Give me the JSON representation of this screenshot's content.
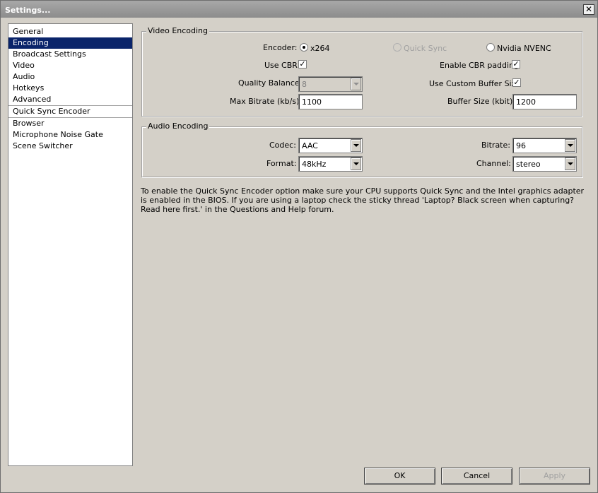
{
  "window": {
    "title": "Settings...",
    "close_glyph": "✕"
  },
  "sidebar": {
    "items": [
      {
        "label": "General"
      },
      {
        "label": "Encoding"
      },
      {
        "label": "Broadcast Settings"
      },
      {
        "label": "Video"
      },
      {
        "label": "Audio"
      },
      {
        "label": "Hotkeys"
      },
      {
        "label": "Advanced"
      },
      {
        "label": "Quick Sync Encoder"
      },
      {
        "label": "Browser"
      },
      {
        "label": "Microphone Noise Gate"
      },
      {
        "label": "Scene Switcher"
      }
    ]
  },
  "video_encoding": {
    "title": "Video Encoding",
    "encoder_label": "Encoder:",
    "encoder_options": [
      "x264",
      "Quick Sync",
      "Nvidia NVENC"
    ],
    "use_cbr_label": "Use CBR",
    "enable_cbr_padding_label": "Enable CBR padding",
    "quality_balance_label": "Quality Balance:",
    "quality_balance_value": "8",
    "use_custom_buffer_label": "Use Custom Buffer Size",
    "max_bitrate_label": "Max Bitrate (kb/s):",
    "max_bitrate_value": "1100",
    "buffer_size_label": "Buffer Size (kbit):",
    "buffer_size_value": "1200",
    "check_glyph": "✓"
  },
  "audio_encoding": {
    "title": "Audio Encoding",
    "codec_label": "Codec:",
    "codec_value": "AAC",
    "bitrate_label": "Bitrate:",
    "bitrate_value": "96",
    "format_label": "Format:",
    "format_value": "48kHz",
    "channel_label": "Channel:",
    "channel_value": "stereo"
  },
  "info_text": "To enable the Quick Sync Encoder option make sure your CPU supports Quick Sync and the Intel graphics adapter is enabled in the BIOS. If you are using a laptop check the sticky thread 'Laptop? Black screen when capturing? Read here first.' in the Questions and Help forum.",
  "buttons": {
    "ok": "OK",
    "cancel": "Cancel",
    "apply": "Apply"
  }
}
